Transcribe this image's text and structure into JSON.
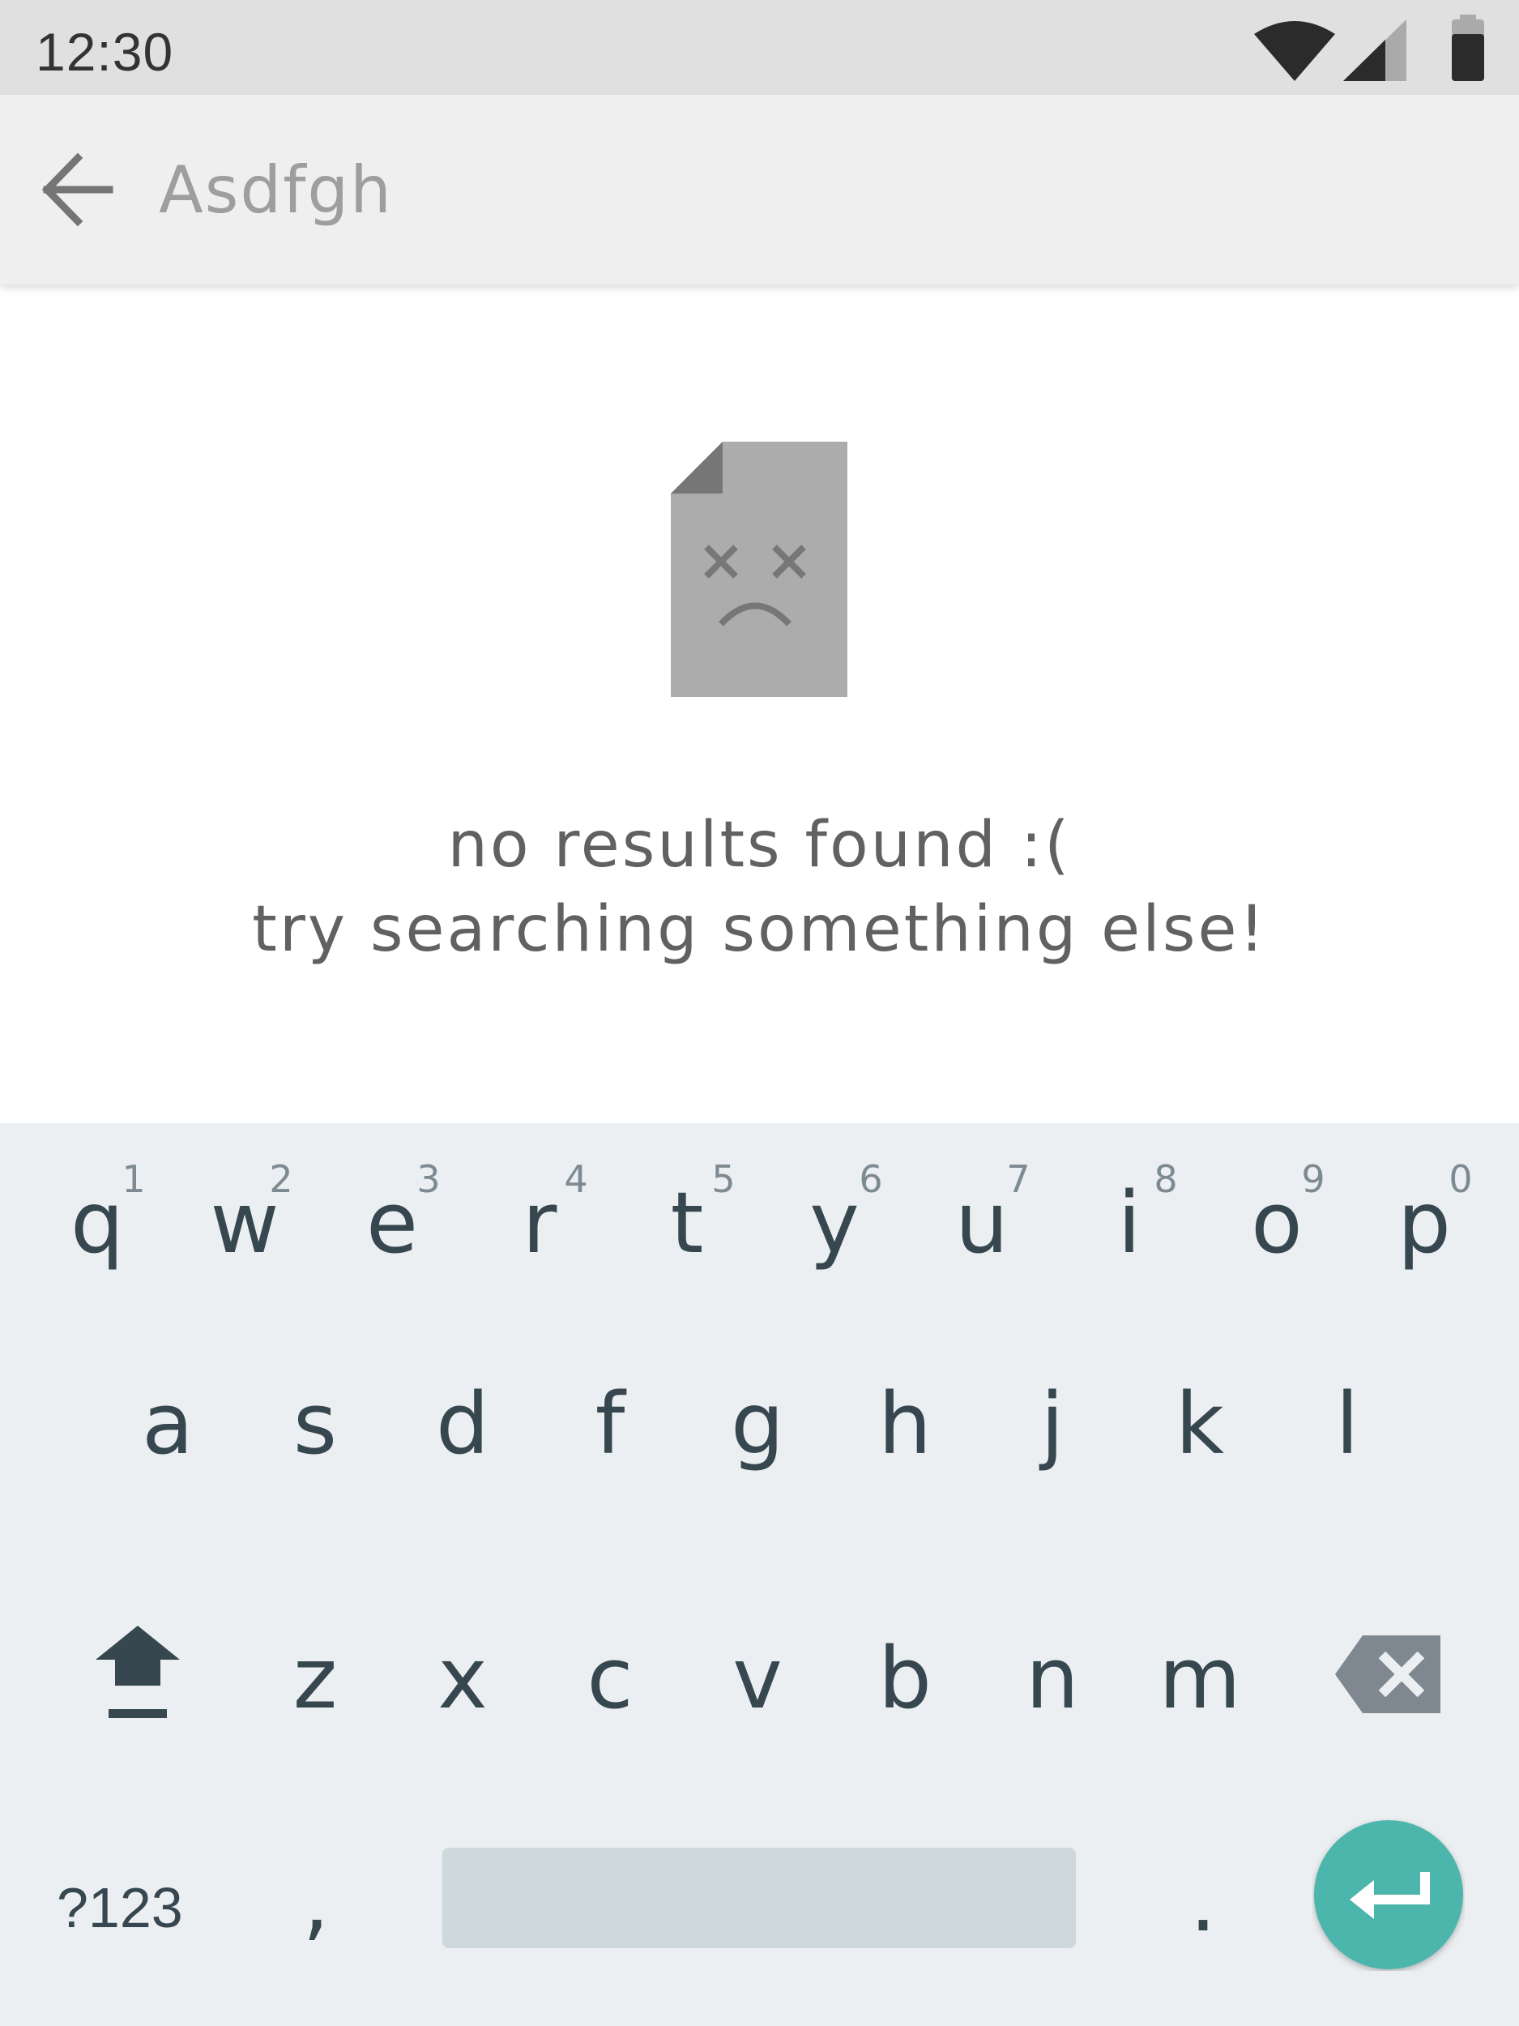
{
  "status_bar": {
    "time": "12:30",
    "icons": [
      "wifi-icon",
      "cellular-signal-icon",
      "battery-icon"
    ]
  },
  "search": {
    "query": "Asdfgh",
    "back_icon": "arrow-back-icon"
  },
  "empty_state": {
    "icon": "sad-document-icon",
    "line1": "no results found :(",
    "line2": "try searching something else!"
  },
  "keyboard": {
    "row1": [
      {
        "key": "q",
        "hint": "1"
      },
      {
        "key": "w",
        "hint": "2"
      },
      {
        "key": "e",
        "hint": "3"
      },
      {
        "key": "r",
        "hint": "4"
      },
      {
        "key": "t",
        "hint": "5"
      },
      {
        "key": "y",
        "hint": "6"
      },
      {
        "key": "u",
        "hint": "7"
      },
      {
        "key": "i",
        "hint": "8"
      },
      {
        "key": "o",
        "hint": "9"
      },
      {
        "key": "p",
        "hint": "0"
      }
    ],
    "row2": [
      "a",
      "s",
      "d",
      "f",
      "g",
      "h",
      "j",
      "k",
      "l"
    ],
    "row3": [
      "z",
      "x",
      "c",
      "v",
      "b",
      "n",
      "m"
    ],
    "symbols_label": "?123",
    "comma": ",",
    "period": ".",
    "shift_icon": "shift-icon",
    "delete_icon": "backspace-icon",
    "enter_icon": "enter-icon"
  },
  "colors": {
    "status_bar_bg": "#e0e0e0",
    "toolbar_bg": "#efefef",
    "keyboard_bg": "#eceff1",
    "key_text": "#37474f",
    "enter_accent": "#4db6ac",
    "placeholder_gray": "#a6a6a6"
  }
}
